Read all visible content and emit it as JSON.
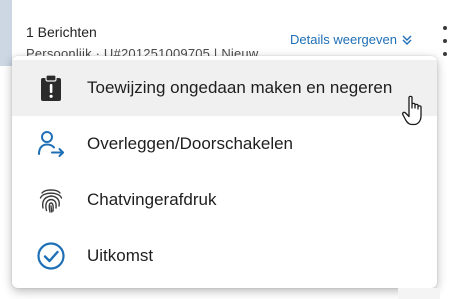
{
  "header": {
    "message_count": "1 Berichten",
    "subline": "Persoonlijk · U#201251009705 | Nieuw",
    "details_link": "Details weergeven",
    "chevron_icon": "double-chevron-down-icon",
    "more_icon": "kebab-menu-icon"
  },
  "menu": {
    "items": [
      {
        "label": "Toewijzing ongedaan maken en negeren",
        "icon": "clipboard-alert-icon",
        "hovered": true
      },
      {
        "label": "Overleggen/Doorschakelen",
        "icon": "person-transfer-icon",
        "hovered": false
      },
      {
        "label": "Chatvingerafdruk",
        "icon": "fingerprint-icon",
        "hovered": false
      },
      {
        "label": "Uitkomst",
        "icon": "check-circle-icon",
        "hovered": false
      }
    ]
  },
  "colors": {
    "accent": "#1f6fb6",
    "hover_bg": "#f0f0f0",
    "rail": "#ccd7e3",
    "icon_dark": "#2b2b2b"
  }
}
